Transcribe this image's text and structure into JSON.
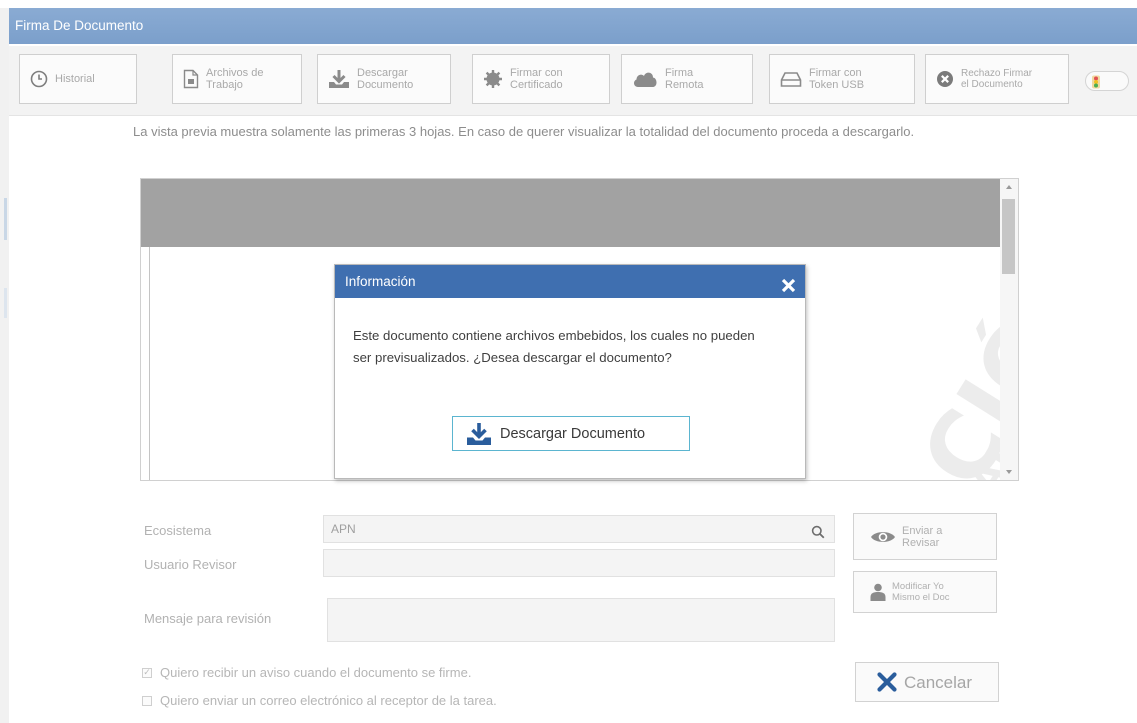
{
  "window": {
    "title": "Firma De Documento"
  },
  "toolbar": {
    "buttons": [
      {
        "line1": "Historial",
        "line2": "",
        "icon": "clock-icon"
      },
      {
        "line1": "Archivos de",
        "line2": "Trabajo",
        "icon": "file-icon"
      },
      {
        "line1": "Descargar",
        "line2": "Documento",
        "icon": "download-icon"
      },
      {
        "line1": "Firmar con",
        "line2": "Certificado",
        "icon": "seal-icon"
      },
      {
        "line1": "Firma",
        "line2": "Remota",
        "icon": "cloud-icon"
      },
      {
        "line1": "Firmar con",
        "line2": "Token USB",
        "icon": "token-icon"
      },
      {
        "line1": "Rechazo Firmar",
        "line2": "el Documento",
        "icon": "reject-icon"
      }
    ]
  },
  "notice": "La vista previa muestra solamente las primeras 3 hojas. En caso de querer visualizar la totalidad del documento proceda a descargarlo.",
  "dialog": {
    "title": "Información",
    "message": "Este documento contiene archivos embebidos, los cuales no pueden ser previsualizados. ¿Desea descargar el documento?",
    "button": "Descargar Documento"
  },
  "form": {
    "ecosistema_label": "Ecosistema",
    "ecosistema_value": "APN",
    "usuario_label": "Usuario Revisor",
    "usuario_value": "",
    "mensaje_label": "Mensaje para revisión",
    "mensaje_value": "",
    "aviso_label": "Quiero recibir un aviso cuando el documento se firme.",
    "aviso_checked": true,
    "correo_label": "Quiero enviar un correo electrónico al receptor de la tarea.",
    "correo_checked": false
  },
  "side_buttons": {
    "enviar_line1": "Enviar a",
    "enviar_line2": "Revisar",
    "modificar_line1": "Modificar Yo",
    "modificar_line2": "Mismo el Doc",
    "cancelar": "Cancelar"
  },
  "colors": {
    "titlebar": "#7b9fcb",
    "dialog_header": "#3f6fb0",
    "dialog_button_border": "#5bb5d0",
    "download_icon": "#2a5d9c",
    "cancel_icon": "#2a5d9c"
  }
}
